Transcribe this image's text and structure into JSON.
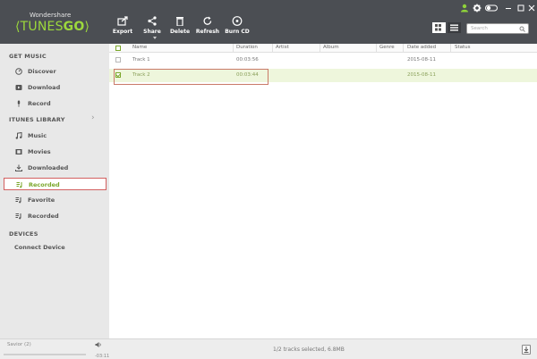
{
  "app": {
    "brand_small": "Wondershare",
    "brand_left": "⟨TUNES",
    "brand_go": "GO",
    "brand_right": "⟩"
  },
  "toolbar": {
    "export_label": "Export",
    "share_label": "Share",
    "delete_label": "Delete",
    "refresh_label": "Refresh",
    "burn_label": "Burn CD"
  },
  "search": {
    "placeholder": "Search"
  },
  "sidebar": {
    "sections": [
      {
        "title": "GET MUSIC"
      },
      {
        "title": "ITUNES LIBRARY"
      },
      {
        "title": "DEVICES"
      }
    ],
    "get_music": [
      {
        "label": "Discover",
        "icon": "compass-icon"
      },
      {
        "label": "Download",
        "icon": "download-icon"
      },
      {
        "label": "Record",
        "icon": "microphone-icon"
      }
    ],
    "itunes": [
      {
        "label": "Music",
        "icon": "music-note-icon"
      },
      {
        "label": "Movies",
        "icon": "film-icon"
      },
      {
        "label": "Downloaded",
        "icon": "download-tray-icon"
      },
      {
        "label": "Recorded",
        "icon": "playlist-icon",
        "active": true
      },
      {
        "label": "Favorite",
        "icon": "playlist-icon"
      },
      {
        "label": "Recorded",
        "icon": "playlist-icon"
      }
    ],
    "devices": [
      {
        "label": "Connect Device"
      }
    ]
  },
  "table": {
    "columns": [
      "Name",
      "Duration",
      "Artist",
      "Album",
      "Genre",
      "Date added",
      "Status"
    ],
    "rows": [
      {
        "name": "Track 1",
        "duration": "00:03:56",
        "artist": "",
        "album": "",
        "genre": "",
        "date": "2015-08-11",
        "status": "",
        "checked": false
      },
      {
        "name": "Track 2",
        "duration": "00:03:44",
        "artist": "",
        "album": "",
        "genre": "",
        "date": "2015-08-11",
        "status": "",
        "checked": true
      }
    ]
  },
  "footer": {
    "device": "Savior (2)",
    "time": "-03:11",
    "status": "1/2 tracks selected, 6.8MB"
  },
  "colors": {
    "topbar": "#4b4e53",
    "accent": "#7aa62a",
    "selected_row": "#eef6dc",
    "sidebar": "#e8e8e8"
  }
}
